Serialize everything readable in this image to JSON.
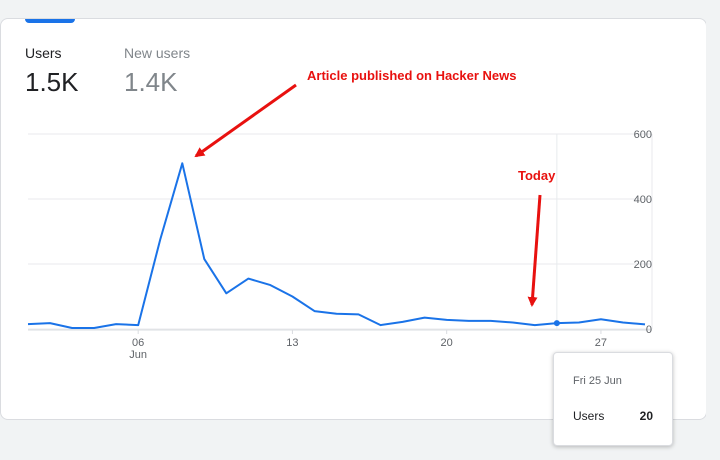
{
  "metrics": [
    {
      "label": "Users",
      "value": "1.5K",
      "active": true
    },
    {
      "label": "New users",
      "value": "1.4K",
      "active": false
    }
  ],
  "annotations": {
    "spike": "Article published on Hacker News",
    "today": "Today"
  },
  "tooltip": {
    "date": "Fri 25 Jun",
    "label": "Users",
    "value": "20"
  },
  "colors": {
    "line": "#1a73e8",
    "annotation": "#e8110f",
    "grid": "#e8eaed"
  },
  "chart_data": {
    "type": "line",
    "series": [
      {
        "name": "Users",
        "x": [
          1,
          2,
          3,
          4,
          5,
          6,
          7,
          8,
          9,
          10,
          11,
          12,
          13,
          14,
          15,
          16,
          17,
          18,
          19,
          20,
          21,
          22,
          23,
          24,
          25,
          26,
          27,
          28,
          29
        ],
        "values": [
          15,
          18,
          3,
          3,
          15,
          12,
          275,
          510,
          215,
          110,
          155,
          135,
          100,
          55,
          47,
          45,
          12,
          22,
          35,
          28,
          25,
          25,
          20,
          12,
          18,
          20,
          30,
          20,
          14
        ]
      }
    ],
    "x_ticks": [
      {
        "x": 6,
        "label": "06",
        "sublabel": "Jun"
      },
      {
        "x": 13,
        "label": "13",
        "sublabel": ""
      },
      {
        "x": 20,
        "label": "20",
        "sublabel": ""
      },
      {
        "x": 27,
        "label": "27",
        "sublabel": ""
      }
    ],
    "y_ticks": [
      0,
      200,
      400,
      600
    ],
    "ylim": [
      0,
      600
    ],
    "xlim": [
      1,
      29
    ],
    "highlight_x": 25,
    "grid": true
  }
}
